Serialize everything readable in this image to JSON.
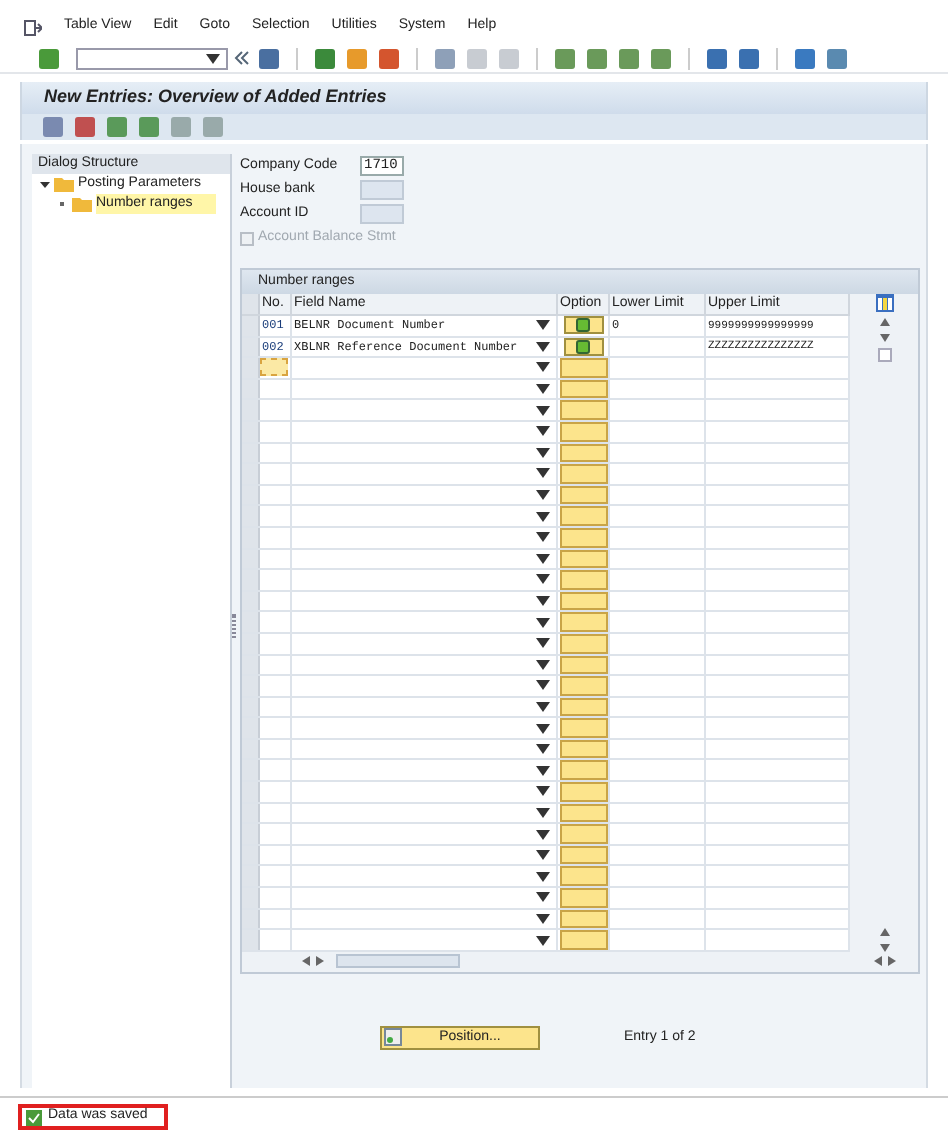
{
  "menu": [
    "Table View",
    "Edit",
    "Goto",
    "Selection",
    "Utilities",
    "System",
    "Help"
  ],
  "title": "New Entries: Overview of Added Entries",
  "tree": {
    "heading": "Dialog Structure",
    "items": [
      {
        "label": "Posting Parameters",
        "expanded": true,
        "selected": false,
        "children": [
          {
            "label": "Number ranges",
            "selected": true
          }
        ]
      }
    ]
  },
  "fields": [
    {
      "kind": "input",
      "label": "Company Code",
      "value": "1710",
      "disabled": false
    },
    {
      "kind": "input",
      "label": "House bank",
      "disabled": true
    },
    {
      "kind": "input",
      "label": "Account ID",
      "disabled": true
    },
    {
      "kind": "checkbox",
      "label": "Account Balance Stmt",
      "checked": false,
      "disabled": true
    }
  ],
  "table": {
    "title": "Number ranges",
    "columns": [
      "No.",
      "Field Name",
      "Option",
      "Lower Limit",
      "Upper Limit"
    ],
    "rows": [
      {
        "no": "001",
        "field_name": "BELNR Document Number",
        "lower": "0",
        "upper": "9999999999999999"
      },
      {
        "no": "002",
        "field_name": "XBLNR Reference Document Number",
        "lower": "",
        "upper": "ZZZZZZZZZZZZZZZZ"
      }
    ]
  },
  "position_button": "Position...",
  "entry_info": "Entry 1 of 2",
  "status": {
    "message": "Data was saved"
  }
}
